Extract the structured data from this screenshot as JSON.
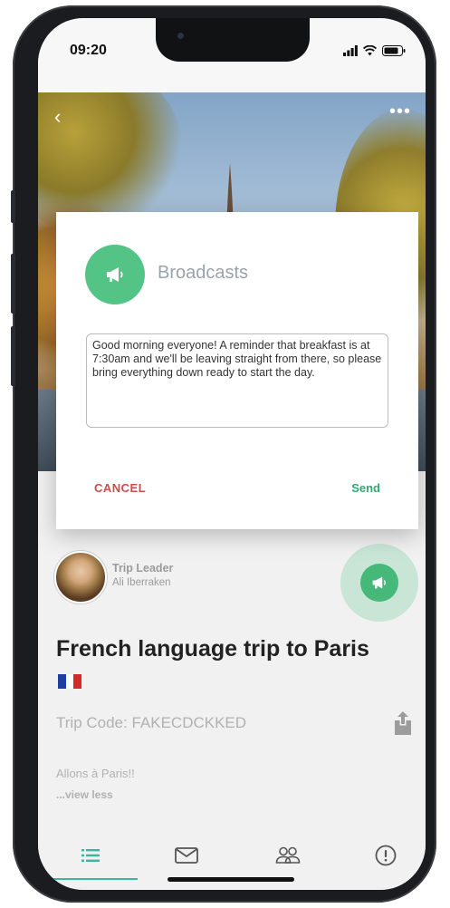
{
  "status_bar": {
    "time": "09:20"
  },
  "broadcast_modal": {
    "title": "Broadcasts",
    "message": "Good morning everyone! A reminder that breakfast is at 7:30am and we'll be leaving straight from there, so please bring everything down ready to start the day.",
    "cancel_label": "CANCEL",
    "send_label": "Send",
    "icon": "megaphone-icon"
  },
  "leader": {
    "role": "Trip Leader",
    "name": "Ali Iberraken"
  },
  "trip": {
    "title": "French language trip to Paris",
    "code_text": "Trip Code: FAKECDCKKED",
    "description": "Allons à Paris!!",
    "view_toggle": "...view less"
  },
  "tabs": [
    {
      "icon": "list-icon",
      "active": true
    },
    {
      "icon": "mail-icon",
      "active": false
    },
    {
      "icon": "people-icon",
      "active": false
    },
    {
      "icon": "alert-icon",
      "active": false
    }
  ],
  "colors": {
    "accent_green": "#54c486",
    "cancel_red": "#d04a4a",
    "tab_active": "#3fb3a0"
  }
}
